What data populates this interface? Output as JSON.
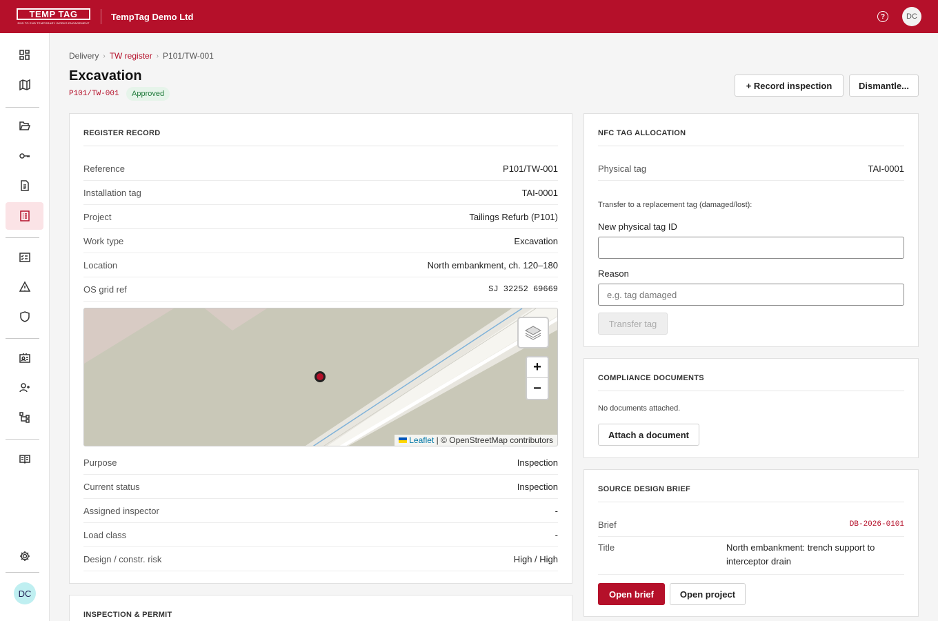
{
  "topbar": {
    "logo_text": "TEMP TAG",
    "logo_tagline": "END TO END TEMPORARY WORKS ENGAGEMENT",
    "org_name": "TempTag Demo Ltd",
    "help_icon": "question-circle-icon",
    "user_initials": "DC"
  },
  "sidebar": {
    "items": [
      {
        "name": "dashboard",
        "icon": "grid-icon"
      },
      {
        "name": "map",
        "icon": "map-icon"
      },
      {
        "name": "projects",
        "icon": "folder-icon"
      },
      {
        "name": "tags",
        "icon": "key-icon"
      },
      {
        "name": "documents",
        "icon": "document-icon"
      },
      {
        "name": "register",
        "icon": "list-icon",
        "active": true
      },
      {
        "name": "inspections",
        "icon": "checklist-icon"
      },
      {
        "name": "hazards",
        "icon": "warning-icon"
      },
      {
        "name": "compliance",
        "icon": "shield-icon"
      },
      {
        "name": "people",
        "icon": "id-card-icon"
      },
      {
        "name": "add-user",
        "icon": "user-plus-icon"
      },
      {
        "name": "hierarchy",
        "icon": "hierarchy-icon"
      },
      {
        "name": "guide",
        "icon": "book-icon"
      },
      {
        "name": "settings",
        "icon": "gear-icon"
      }
    ],
    "user_initials": "DC"
  },
  "breadcrumb": {
    "items": [
      "Delivery",
      "TW register",
      "P101/TW-001"
    ]
  },
  "header": {
    "title": "Excavation",
    "ref": "P101/TW-001",
    "status": "Approved",
    "record_inspection_label": "+ Record inspection",
    "dismantle_label": "Dismantle..."
  },
  "register": {
    "title": "REGISTER RECORD",
    "rows": [
      {
        "label": "Reference",
        "value": "P101/TW-001"
      },
      {
        "label": "Installation tag",
        "value": "TAI-0001"
      },
      {
        "label": "Project",
        "value": "Tailings Refurb (P101)"
      },
      {
        "label": "Work type",
        "value": "Excavation"
      },
      {
        "label": "Location",
        "value": "North embankment, ch. 120–180"
      },
      {
        "label": "OS grid ref",
        "value": "SJ 32252 69669"
      }
    ],
    "rows2": [
      {
        "label": "Purpose",
        "value": "Inspection"
      },
      {
        "label": "Current status",
        "value": "Inspection"
      },
      {
        "label": "Assigned inspector",
        "value": "-"
      },
      {
        "label": "Load class",
        "value": "-"
      },
      {
        "label": "Design / constr. risk",
        "value": "High / High"
      }
    ],
    "map": {
      "attribution_leaflet": "Leaflet",
      "attribution_rest": " | © OpenStreetMap contributors",
      "zoom_in": "+",
      "zoom_out": "−"
    }
  },
  "inspection": {
    "title": "INSPECTION & PERMIT"
  },
  "nfc": {
    "title": "NFC TAG ALLOCATION",
    "physical_tag_label": "Physical tag",
    "physical_tag_value": "TAI-0001",
    "transfer_text": "Transfer to a replacement tag (damaged/lost):",
    "new_tag_label": "New physical tag ID",
    "new_tag_value": "",
    "reason_label": "Reason",
    "reason_placeholder": "e.g. tag damaged",
    "transfer_button": "Transfer tag"
  },
  "compliance": {
    "title": "COMPLIANCE DOCUMENTS",
    "empty_text": "No documents attached.",
    "attach_button": "Attach a document"
  },
  "brief": {
    "title": "SOURCE DESIGN BRIEF",
    "brief_label": "Brief",
    "brief_value": "DB-2026-0101",
    "title_label": "Title",
    "title_value": "North embankment: trench support to interceptor drain",
    "open_brief": "Open brief",
    "open_project": "Open project"
  },
  "colors": {
    "brand": "#b5102a",
    "approved_bg": "#e6f4ea",
    "approved_text": "#1f7a3a"
  }
}
